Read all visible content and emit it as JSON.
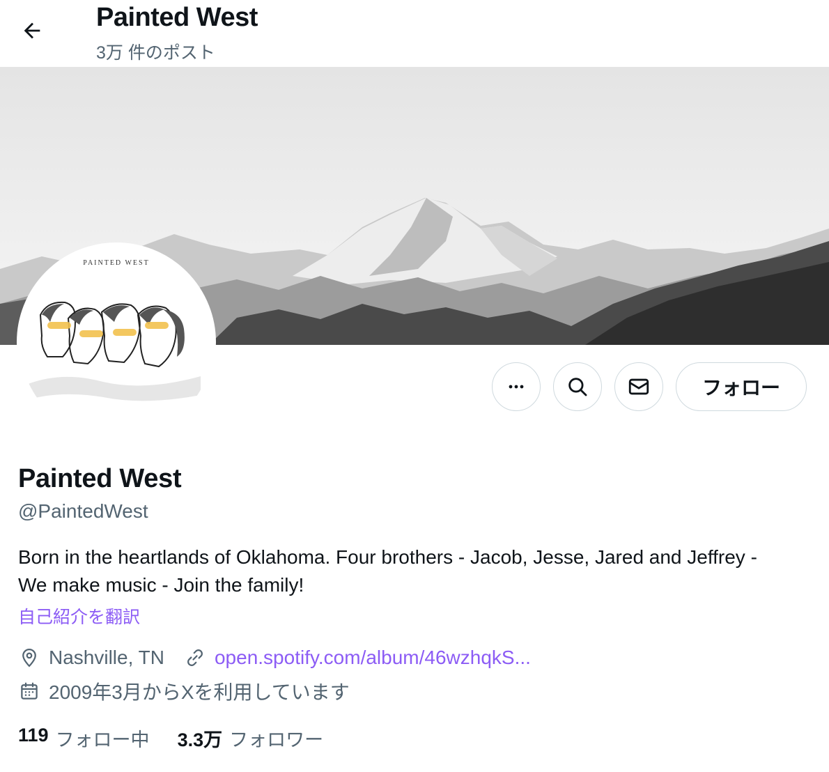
{
  "header": {
    "title": "Painted West",
    "post_count": "3万 件のポスト"
  },
  "avatar": {
    "caption": "PAINTED WEST"
  },
  "actions": {
    "follow_label": "フォロー"
  },
  "profile": {
    "name": "Painted West",
    "handle": "@PaintedWest",
    "bio": "Born in the heartlands of Oklahoma. Four brothers - Jacob, Jesse, Jared and Jeffrey - We make music - Join the family!",
    "translate_label": "自己紹介を翻訳",
    "location": "Nashville, TN",
    "website": "open.spotify.com/album/46wzhqkS...",
    "joined": "2009年3月からXを利用しています"
  },
  "stats": {
    "following_count": "119",
    "following_label": "フォロー中",
    "followers_count": "3.3万",
    "followers_label": "フォロワー"
  },
  "colors": {
    "link": "#8c5cf5",
    "secondary_text": "#536471",
    "primary_text": "#0f1419",
    "border": "#cfd9de",
    "avatar_stripe": "#f2c14e"
  }
}
